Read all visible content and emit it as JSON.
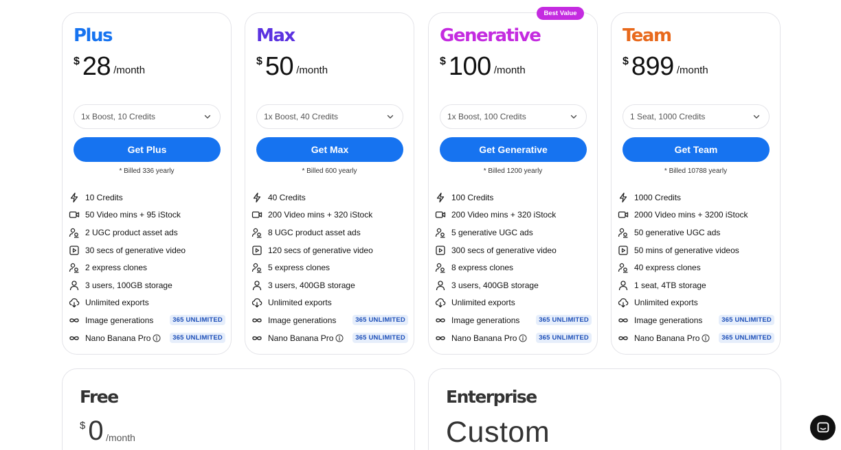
{
  "plans": [
    {
      "name": "Plus",
      "color": "#1673f0",
      "currency": "$",
      "amount": "28",
      "period": "/month",
      "select_value": "1x Boost, 10 Credits",
      "cta": "Get Plus",
      "billed": "* Billed 336 yearly",
      "features": [
        {
          "icon": "bolt-icon",
          "text": "10 Credits",
          "badge": ""
        },
        {
          "icon": "video-icon",
          "text": "50 Video mins + 95 iStock",
          "badge": ""
        },
        {
          "icon": "users-icon",
          "text": "2 UGC product asset ads",
          "badge": ""
        },
        {
          "icon": "play-icon",
          "text": "30 secs of generative video",
          "badge": ""
        },
        {
          "icon": "users-icon",
          "text": "2 express clones",
          "badge": ""
        },
        {
          "icon": "user-icon",
          "text": "3 users, 100GB storage",
          "badge": ""
        },
        {
          "icon": "cloud-download-icon",
          "text": "Unlimited exports",
          "badge": ""
        },
        {
          "icon": "infinity-icon",
          "text": "Image generations",
          "badge": "365 UNLIMITED"
        },
        {
          "icon": "infinity-icon",
          "text": "Nano Banana Pro",
          "badge": "365 UNLIMITED",
          "info": true
        }
      ]
    },
    {
      "name": "Max",
      "color": "#5b32e0",
      "currency": "$",
      "amount": "50",
      "period": "/month",
      "select_value": "1x Boost, 40 Credits",
      "cta": "Get Max",
      "billed": "* Billed 600 yearly",
      "features": [
        {
          "icon": "bolt-icon",
          "text": "40 Credits",
          "badge": ""
        },
        {
          "icon": "video-icon",
          "text": "200 Video mins + 320 iStock",
          "badge": ""
        },
        {
          "icon": "users-icon",
          "text": "8 UGC product asset ads",
          "badge": ""
        },
        {
          "icon": "play-icon",
          "text": "120 secs of generative video",
          "badge": ""
        },
        {
          "icon": "users-icon",
          "text": "5 express clones",
          "badge": ""
        },
        {
          "icon": "user-icon",
          "text": "3 users, 400GB storage",
          "badge": ""
        },
        {
          "icon": "cloud-download-icon",
          "text": "Unlimited exports",
          "badge": ""
        },
        {
          "icon": "infinity-icon",
          "text": "Image generations",
          "badge": "365 UNLIMITED"
        },
        {
          "icon": "infinity-icon",
          "text": "Nano Banana Pro",
          "badge": "365 UNLIMITED",
          "info": true
        }
      ]
    },
    {
      "name": "Generative",
      "color": "#c42be0",
      "currency": "$",
      "amount": "100",
      "period": "/month",
      "select_value": "1x Boost, 100 Credits",
      "cta": "Get Generative",
      "billed": "* Billed 1200 yearly",
      "features": [
        {
          "icon": "bolt-icon",
          "text": "100 Credits",
          "badge": ""
        },
        {
          "icon": "video-icon",
          "text": "200 Video mins + 320 iStock",
          "badge": ""
        },
        {
          "icon": "users-icon",
          "text": "5 generative UGC ads",
          "badge": ""
        },
        {
          "icon": "play-icon",
          "text": "300 secs of generative video",
          "badge": ""
        },
        {
          "icon": "users-icon",
          "text": "8 express clones",
          "badge": ""
        },
        {
          "icon": "user-icon",
          "text": "3 users, 400GB storage",
          "badge": ""
        },
        {
          "icon": "cloud-download-icon",
          "text": "Unlimited exports",
          "badge": ""
        },
        {
          "icon": "infinity-icon",
          "text": "Image generations",
          "badge": "365 UNLIMITED"
        },
        {
          "icon": "infinity-icon",
          "text": "Nano Banana Pro",
          "badge": "365 UNLIMITED",
          "info": true
        }
      ]
    },
    {
      "name": "Team",
      "color": "#e8691c",
      "currency": "$",
      "amount": "899",
      "period": "/month",
      "select_value": "1 Seat, 1000 Credits",
      "cta": "Get Team",
      "billed": "* Billed 10788 yearly",
      "features": [
        {
          "icon": "bolt-icon",
          "text": "1000 Credits",
          "badge": ""
        },
        {
          "icon": "video-icon",
          "text": "2000 Video mins + 3200 iStock",
          "badge": ""
        },
        {
          "icon": "users-icon",
          "text": "50 generative UGC ads",
          "badge": ""
        },
        {
          "icon": "play-icon",
          "text": "50 mins of generative videos",
          "badge": ""
        },
        {
          "icon": "users-icon",
          "text": "40 express clones",
          "badge": ""
        },
        {
          "icon": "user-icon",
          "text": "1 seat, 4TB storage",
          "badge": ""
        },
        {
          "icon": "cloud-download-icon",
          "text": "Unlimited exports",
          "badge": ""
        },
        {
          "icon": "infinity-icon",
          "text": "Image generations",
          "badge": "365 UNLIMITED"
        },
        {
          "icon": "infinity-icon",
          "text": "Nano Banana Pro",
          "badge": "365 UNLIMITED",
          "info": true
        }
      ]
    }
  ],
  "best_value_badge": "Best Value",
  "free": {
    "name": "Free",
    "currency": "$",
    "amount": "0",
    "period": "/month"
  },
  "enterprise": {
    "name": "Enterprise",
    "price_label": "Custom"
  },
  "chat_button": {
    "icon": "chat-icon"
  }
}
